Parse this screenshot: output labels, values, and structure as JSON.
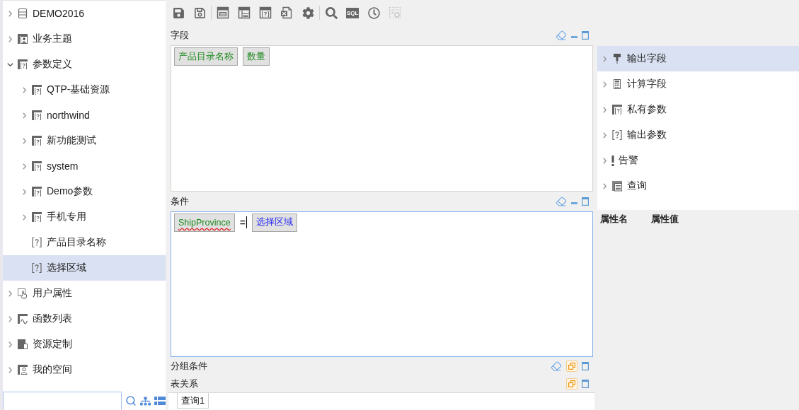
{
  "tree": {
    "items": [
      {
        "label": "DEMO2016",
        "kind": "database",
        "expanded": false,
        "selected": false
      },
      {
        "label": "业务主题",
        "kind": "subject",
        "expanded": false,
        "selected": false
      },
      {
        "label": "参数定义",
        "kind": "param-folder",
        "expanded": true,
        "selected": false,
        "children": [
          {
            "label": "QTP-基础资源",
            "kind": "param-folder",
            "expanded": false,
            "selected": false
          },
          {
            "label": "northwind",
            "kind": "param-folder",
            "expanded": false,
            "selected": false
          },
          {
            "label": "新功能测试",
            "kind": "param-folder",
            "expanded": false,
            "selected": false
          },
          {
            "label": "system",
            "kind": "param-folder",
            "expanded": false,
            "selected": false
          },
          {
            "label": "Demo参数",
            "kind": "param-folder",
            "expanded": false,
            "selected": false
          },
          {
            "label": "手机专用",
            "kind": "param-folder",
            "expanded": false,
            "selected": false
          },
          {
            "label": "产品目录名称",
            "kind": "param",
            "selected": false
          },
          {
            "label": "选择区域",
            "kind": "param",
            "selected": true
          }
        ]
      },
      {
        "label": "用户属性",
        "kind": "user-attr",
        "expanded": false,
        "selected": false
      },
      {
        "label": "函数列表",
        "kind": "function",
        "expanded": false,
        "selected": false
      },
      {
        "label": "资源定制",
        "kind": "resource",
        "expanded": false,
        "selected": false
      },
      {
        "label": "我的空间",
        "kind": "space",
        "expanded": false,
        "selected": false
      }
    ]
  },
  "toolbar": {
    "groups": [
      {
        "buttons": [
          {
            "kind": "save",
            "disabled": false
          },
          {
            "kind": "save-as",
            "disabled": false
          }
        ]
      },
      {
        "buttons": [
          {
            "kind": "layout",
            "disabled": false
          },
          {
            "kind": "table",
            "disabled": false
          },
          {
            "kind": "param-window",
            "disabled": false
          },
          {
            "kind": "excel",
            "disabled": false
          },
          {
            "kind": "settings",
            "disabled": false
          }
        ]
      },
      {
        "buttons": [
          {
            "kind": "search",
            "disabled": false
          },
          {
            "kind": "sql",
            "label": "SQL",
            "disabled": false
          },
          {
            "kind": "history",
            "disabled": false
          },
          {
            "kind": "add-window",
            "disabled": true
          }
        ]
      }
    ]
  },
  "sections": [
    {
      "title": "字段",
      "collapsed": false,
      "clearable": true,
      "focused": false,
      "tokens": [
        {
          "kind": "field",
          "label": "产品目录名称",
          "misspelled": false
        },
        {
          "kind": "field",
          "label": "数量",
          "misspelled": false
        }
      ]
    },
    {
      "title": "条件",
      "collapsed": false,
      "clearable": true,
      "focused": true,
      "tokens": [
        {
          "kind": "field",
          "label": "ShipProvince",
          "misspelled": true
        },
        {
          "kind": "operator",
          "label": "=",
          "caret": true
        },
        {
          "kind": "param",
          "label": "选择区域",
          "misspelled": false
        }
      ]
    },
    {
      "title": "分组条件",
      "collapsed": true,
      "clearable": true
    },
    {
      "title": "表关系",
      "collapsed": true,
      "clearable": false
    }
  ],
  "query_tabs": [
    {
      "label": "查询1",
      "selected": true
    }
  ],
  "output_panel": {
    "items": [
      {
        "label": "输出字段",
        "kind": "output-field",
        "expanded": false,
        "selected": true
      },
      {
        "label": "计算字段",
        "kind": "calc-field",
        "expanded": false,
        "selected": false
      },
      {
        "label": "私有参数",
        "kind": "param-folder",
        "expanded": false,
        "selected": false
      },
      {
        "label": "输出参数",
        "kind": "param",
        "expanded": false,
        "selected": false
      },
      {
        "label": "告警",
        "kind": "alert",
        "expanded": false,
        "selected": false
      },
      {
        "label": "查询",
        "kind": "query",
        "expanded": false,
        "selected": false
      }
    ]
  },
  "properties": {
    "columns": [
      "属性名",
      "属性值"
    ]
  }
}
